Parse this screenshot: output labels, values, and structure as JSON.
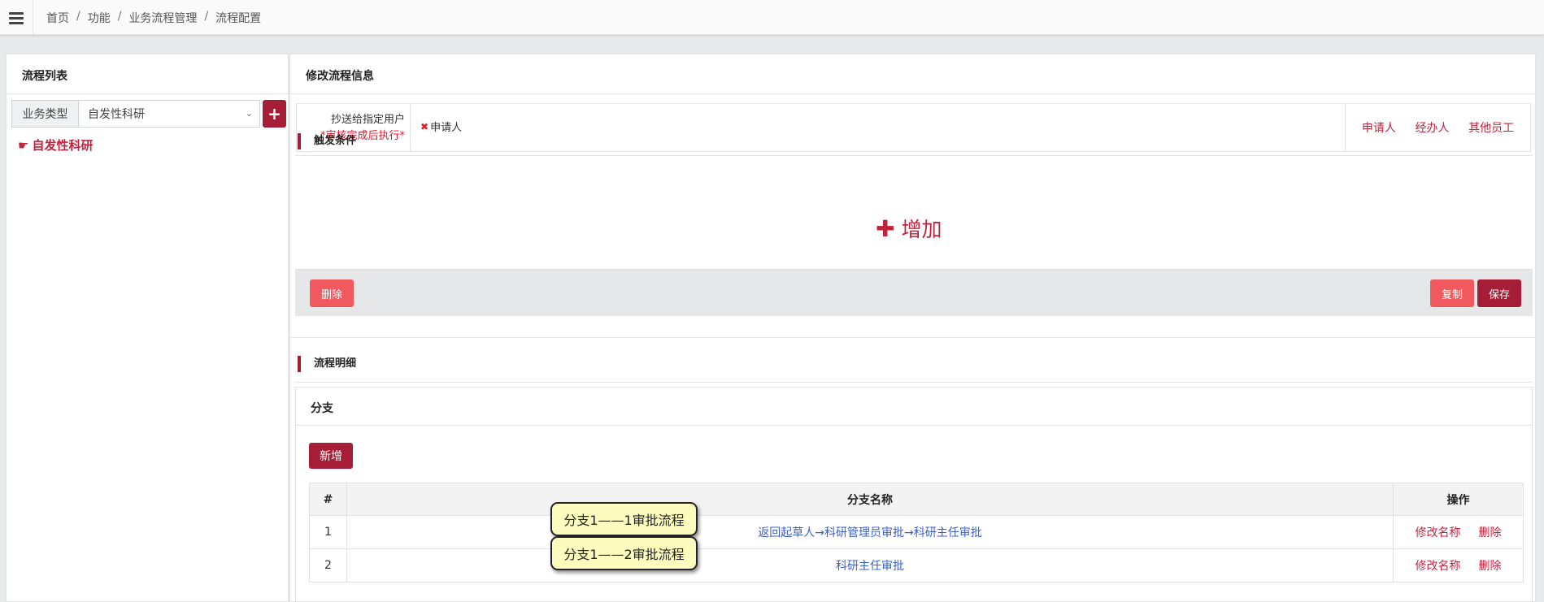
{
  "breadcrumb": [
    "首页",
    "功能",
    "业务流程管理",
    "流程配置"
  ],
  "left_panel": {
    "title": "流程列表",
    "filter_label": "业务类型",
    "filter_value": "自发性科研",
    "add_icon": "plus-icon",
    "tree_item": "自发性科研",
    "tree_icon": "hand-pointer-icon"
  },
  "right_panel": {
    "title": "修改流程信息",
    "cc": {
      "label": "抄送给指定用户",
      "note": "*审核完成后执行*",
      "value": "申请人",
      "links": [
        "申请人",
        "经办人",
        "其他员工"
      ]
    },
    "trigger_title": "触发条件",
    "add_label": "增加",
    "delete_label": "删除",
    "copy_label": "复制",
    "save_label": "保存",
    "detail_title": "流程明细",
    "branch_title": "分支",
    "new_label": "新增",
    "table": {
      "headers": [
        "#",
        "分支名称",
        "操作"
      ],
      "rows": [
        {
          "num": "1",
          "name": "返回起草人→科研管理员审批→科研主任审批",
          "tip": "分支1——1审批流程"
        },
        {
          "num": "2",
          "name": "科研主任审批",
          "tip": "分支1——2审批流程"
        }
      ],
      "ops": [
        "修改名称",
        "删除"
      ]
    }
  },
  "colors": {
    "brand": "#a51d36",
    "danger": "#f05a5e",
    "link": "#3a5fc8",
    "tooltip": "#fdfbbe"
  }
}
